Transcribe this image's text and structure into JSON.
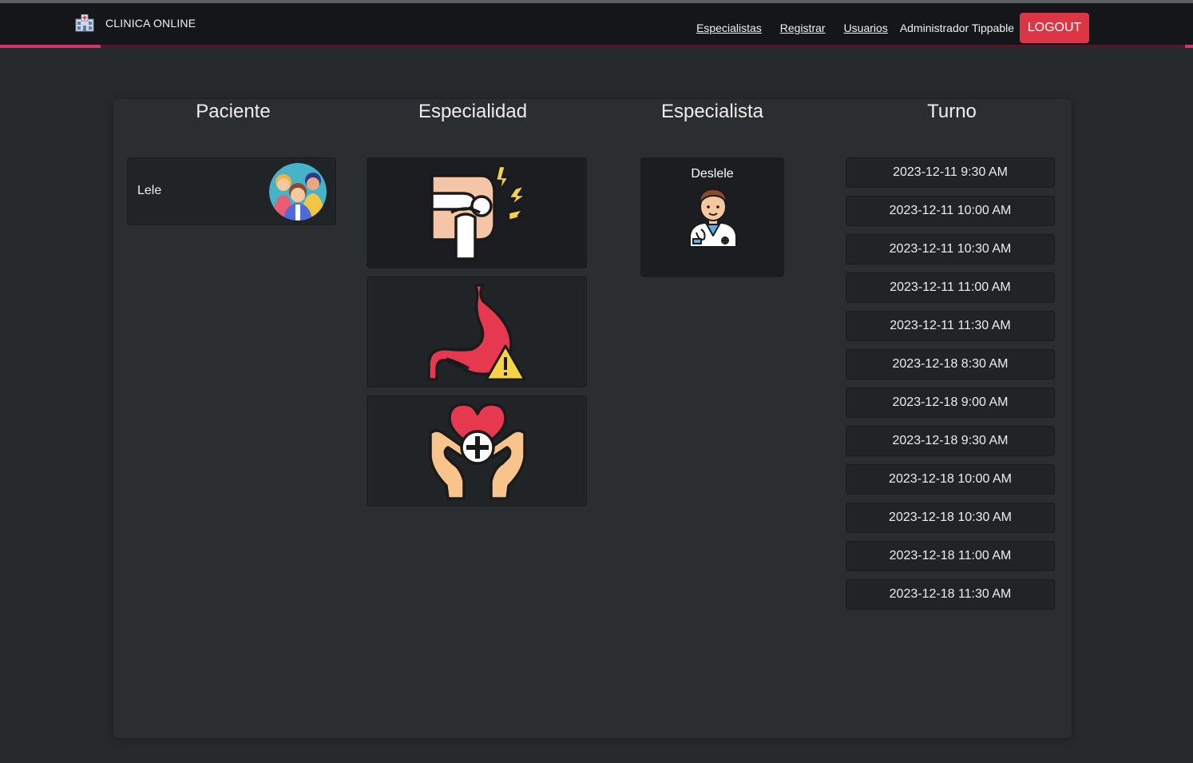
{
  "navbar": {
    "brand": "CLINICA ONLINE",
    "links": [
      "Especialistas",
      "Registrar",
      "Usuarios"
    ],
    "user": "Administrador Tippable",
    "logout_label": "LOGOUT"
  },
  "columns": {
    "paciente": "Paciente",
    "especialidad": "Especialidad",
    "especialista": "Especialista",
    "turno": "Turno"
  },
  "patient": {
    "name": "Lele",
    "icon": "family-avatar-icon"
  },
  "specialties": [
    {
      "icon": "knee-pain-icon"
    },
    {
      "icon": "stomach-warning-icon"
    },
    {
      "icon": "heart-care-icon"
    }
  ],
  "specialist": {
    "name": "Deslele",
    "icon": "doctor-avatar-icon"
  },
  "turnos": [
    "2023-12-11 9:30 AM",
    "2023-12-11 10:00 AM",
    "2023-12-11 10:30 AM",
    "2023-12-11 11:00 AM",
    "2023-12-11 11:30 AM",
    "2023-12-18 8:30 AM",
    "2023-12-18 9:00 AM",
    "2023-12-18 9:30 AM",
    "2023-12-18 10:00 AM",
    "2023-12-18 10:30 AM",
    "2023-12-18 11:00 AM",
    "2023-12-18 11:30 AM"
  ],
  "colors": {
    "accent": "#d6336c",
    "logout": "#dc3545",
    "background": "#272a2d",
    "panel": "#2b2e31"
  }
}
